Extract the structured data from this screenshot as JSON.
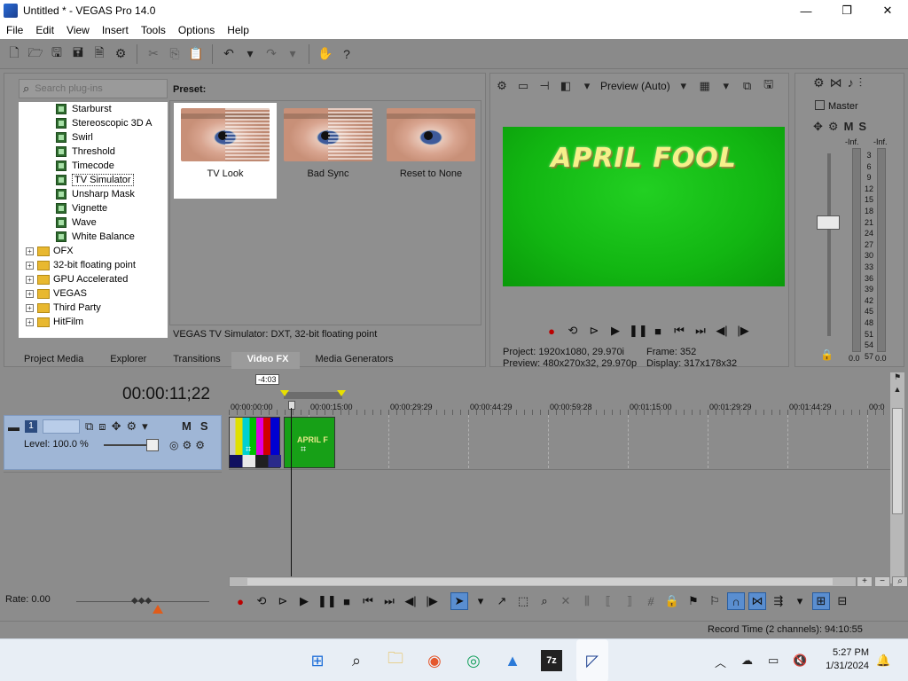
{
  "window": {
    "title": "Untitled * - VEGAS Pro 14.0",
    "minimize": "—",
    "maximize": "❐",
    "close": "✕"
  },
  "menu": [
    "File",
    "Edit",
    "View",
    "Insert",
    "Tools",
    "Options",
    "Help"
  ],
  "plugins": {
    "search_placeholder": "Search plug-ins",
    "tree": [
      {
        "label": "Starburst",
        "type": "fx"
      },
      {
        "label": "Stereoscopic 3D A",
        "type": "fx"
      },
      {
        "label": "Swirl",
        "type": "fx"
      },
      {
        "label": "Threshold",
        "type": "fx"
      },
      {
        "label": "Timecode",
        "type": "fx"
      },
      {
        "label": "TV Simulator",
        "type": "fx",
        "selected": true
      },
      {
        "label": "Unsharp Mask",
        "type": "fx"
      },
      {
        "label": "Vignette",
        "type": "fx"
      },
      {
        "label": "Wave",
        "type": "fx"
      },
      {
        "label": "White Balance",
        "type": "fx"
      },
      {
        "label": "OFX",
        "type": "folder"
      },
      {
        "label": "32-bit floating point",
        "type": "folder"
      },
      {
        "label": "GPU Accelerated",
        "type": "folder"
      },
      {
        "label": "VEGAS",
        "type": "folder"
      },
      {
        "label": "Third Party",
        "type": "folder"
      },
      {
        "label": "HitFilm",
        "type": "folder"
      }
    ],
    "preset_label": "Preset:",
    "presets": [
      {
        "name": "TV Look",
        "selected": true
      },
      {
        "name": "Bad Sync",
        "selected": false
      },
      {
        "name": "Reset to None",
        "selected": false
      }
    ],
    "status": "VEGAS TV Simulator: DXT, 32-bit floating point",
    "tabs": [
      "Project Media",
      "Explorer",
      "Transitions",
      "Video FX",
      "Media Generators"
    ],
    "active_tab": "Video FX"
  },
  "preview": {
    "mode": "Preview (Auto)",
    "screen_text": "APRIL FOOL",
    "project_label": "Project:",
    "project_value": "1920x1080, 29.970i",
    "preview_label": "Preview:",
    "preview_value": "480x270x32, 29.970p",
    "frame_label": "Frame:",
    "frame_value": "352",
    "display_label": "Display:",
    "display_value": "317x178x32"
  },
  "master": {
    "title": "Master",
    "m": "M",
    "s": "S",
    "inf_left": "-Inf.",
    "inf_right": "-Inf.",
    "scale": [
      "3",
      "6",
      "9",
      "12",
      "15",
      "18",
      "21",
      "24",
      "27",
      "30",
      "33",
      "36",
      "39",
      "42",
      "45",
      "48",
      "51",
      "54",
      "57"
    ],
    "zero_left": "0.0",
    "zero_right": "0.0"
  },
  "timeline": {
    "timecode": "00:00:11;22",
    "ruler_box": "-4:03",
    "ruler_labels": [
      "00:00:00:00",
      "00:00:15:00",
      "00:00:29:29",
      "00:00:44:29",
      "00:00:59:28",
      "00:01:15:00",
      "00:01:29:29",
      "00:01:44:29",
      "00:0"
    ],
    "track_number": "1",
    "track_m": "M",
    "track_s": "S",
    "level": "Level: 100.0 %",
    "clip2_text": "APRIL F",
    "rate": "Rate: 0.00"
  },
  "status": {
    "record_time": "Record Time (2 channels): 94:10:55"
  },
  "taskbar": {
    "time": "5:27 PM",
    "date": "1/31/2024"
  }
}
